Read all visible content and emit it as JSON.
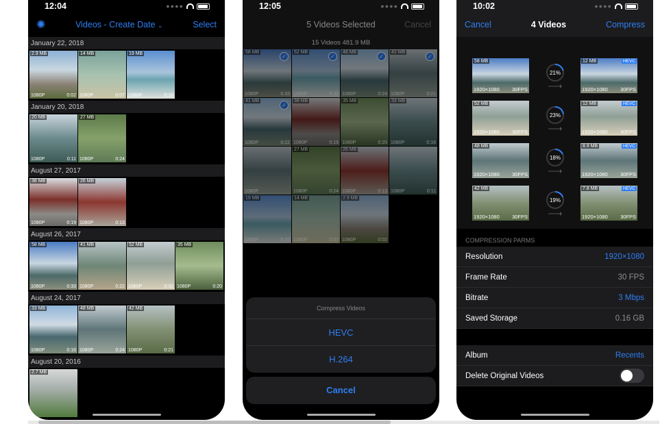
{
  "phone1": {
    "time": "12:04",
    "title": "Videos - Create Date",
    "select_label": "Select",
    "sections": [
      {
        "date": "January 22, 2018",
        "items": [
          {
            "size": "2.9 MB",
            "res": "1080P",
            "dur": "0:02",
            "g": "g1"
          },
          {
            "size": "14 MB",
            "res": "1080P",
            "dur": "0:07",
            "g": "g2"
          },
          {
            "size": "19 MB",
            "res": "1080P",
            "dur": "0:10",
            "g": "g3"
          }
        ]
      },
      {
        "date": "January 20, 2018",
        "items": [
          {
            "size": "20 MB",
            "res": "1080P",
            "dur": "0:11",
            "g": "g4"
          },
          {
            "size": "27 MB",
            "res": "1080P",
            "dur": "0:24",
            "g": "g5"
          }
        ]
      },
      {
        "date": "August 27, 2017",
        "items": [
          {
            "size": "38 MB",
            "res": "1080P",
            "dur": "0:19",
            "g": "g6"
          },
          {
            "size": "26 MB",
            "res": "1080P",
            "dur": "0:13",
            "g": "g7"
          }
        ]
      },
      {
        "date": "August 26, 2017",
        "items": [
          {
            "size": "58 MB",
            "res": "1080P",
            "dur": "0:33",
            "g": "g8"
          },
          {
            "size": "41 MB",
            "res": "1080P",
            "dur": "0:22",
            "g": "g9"
          },
          {
            "size": "52 MB",
            "res": "1080P",
            "dur": "0:32",
            "g": "g10"
          },
          {
            "size": "35 MB",
            "res": "1080P",
            "dur": "0:20",
            "g": "g11"
          }
        ]
      },
      {
        "date": "August 24, 2017",
        "items": [
          {
            "size": "33 MB",
            "res": "1080P",
            "dur": "0:16",
            "g": "g12"
          },
          {
            "size": "48 MB",
            "res": "1080P",
            "dur": "0:24",
            "g": "g13"
          },
          {
            "size": "42 MB",
            "res": "1080P",
            "dur": "0:21",
            "g": "g14"
          }
        ]
      },
      {
        "date": "August 20, 2016",
        "items": [
          {
            "size": "2.7 MB",
            "res": "",
            "dur": "",
            "g": "g15"
          }
        ]
      }
    ]
  },
  "phone2": {
    "time": "12:05",
    "title": "5 Videos Selected",
    "cancel_label": "Cancel",
    "subtitle": "15 Videos   481.9 MB",
    "rows": [
      [
        {
          "size": "58 MB",
          "res": "1080P",
          "dur": "0:33",
          "g": "g8",
          "checked": true
        },
        {
          "size": "52 MB",
          "res": "1080P",
          "dur": "0:32",
          "g": "g3",
          "checked": true
        },
        {
          "size": "48 MB",
          "res": "1080P",
          "dur": "0:24",
          "g": "g12",
          "checked": true
        },
        {
          "size": "42 MB",
          "res": "1080P",
          "dur": "0:21",
          "g": "g13",
          "checked": true
        }
      ],
      [
        {
          "size": "41 MB",
          "res": "1080P",
          "dur": "0:22",
          "g": "g12",
          "checked": true
        },
        {
          "size": "38 MB",
          "res": "1080P",
          "dur": "0:19",
          "g": "g6",
          "checked": false
        },
        {
          "size": "35 MB",
          "res": "1080P",
          "dur": "0:20",
          "g": "g11",
          "checked": false
        },
        {
          "size": "33 MB",
          "res": "1080P",
          "dur": "0:16",
          "g": "g4",
          "checked": false
        }
      ],
      [
        {
          "size": "",
          "res": "1080P",
          "dur": "",
          "g": "g13",
          "checked": false
        },
        {
          "size": "27 MB",
          "res": "1080P",
          "dur": "0:24",
          "g": "g5",
          "checked": false
        },
        {
          "size": "26 MB",
          "res": "1080P",
          "dur": "0:13",
          "g": "g7",
          "checked": false
        },
        {
          "size": "",
          "res": "1080P",
          "dur": "0:11",
          "g": "g4",
          "checked": false
        }
      ],
      [
        {
          "size": "19 MB",
          "res": "1080P",
          "dur": "0:10",
          "g": "g3",
          "checked": false
        },
        {
          "size": "14 MB",
          "res": "1080P",
          "dur": "0:07",
          "g": "g2",
          "checked": false
        },
        {
          "size": "2.9 MB",
          "res": "1080P",
          "dur": "0:02",
          "g": "g1",
          "checked": false
        }
      ]
    ],
    "sheet": {
      "title": "Compress Videos",
      "options": [
        "HEVC",
        "H.264"
      ],
      "cancel": "Cancel"
    }
  },
  "phone3": {
    "time": "10:02",
    "cancel_label": "Cancel",
    "title": "4 Videos",
    "compress_label": "Compress",
    "items": [
      {
        "orig_size": "58 MB",
        "new_size": "12 MB",
        "percent": 21,
        "percent_label": "21%",
        "g": "g8"
      },
      {
        "orig_size": "52 MB",
        "new_size": "12 MB",
        "percent": 23,
        "percent_label": "23%",
        "g": "g10"
      },
      {
        "orig_size": "48 MB",
        "new_size": "8.9 MB",
        "percent": 18,
        "percent_label": "18%",
        "g": "g13"
      },
      {
        "orig_size": "42 MB",
        "new_size": "7.8 MB",
        "percent": 19,
        "percent_label": "19%",
        "g": "g14"
      }
    ],
    "resolution": "1920×1080",
    "fps": "30FPS",
    "codec_badge": "HEVC",
    "params_label": "COMPRESSION PARMS",
    "settings": [
      {
        "label": "Resolution",
        "value": "1920×1080",
        "accent": true
      },
      {
        "label": "Frame Rate",
        "value": "30 FPS",
        "accent": false
      },
      {
        "label": "Bitrate",
        "value": "3 Mbps",
        "accent": true
      },
      {
        "label": "Saved Storage",
        "value": "0.16 GB",
        "accent": false
      }
    ],
    "album_label": "Album",
    "album_value": "Recents",
    "delete_label": "Delete Original Videos",
    "delete_enabled": false
  },
  "colors": {
    "accent": "#2f7ff4",
    "background": "#000000",
    "cell": "#1c1c1e"
  }
}
